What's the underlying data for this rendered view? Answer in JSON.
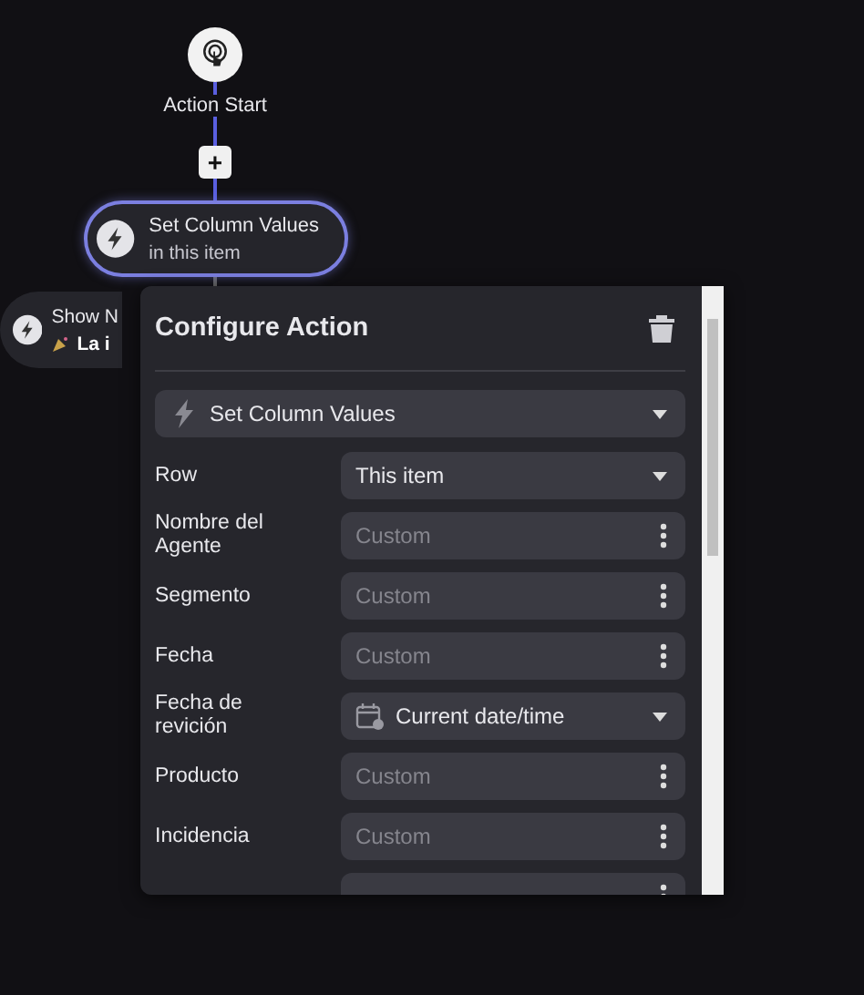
{
  "start_node": {
    "label": "Action Start"
  },
  "add_button": {
    "label": "+"
  },
  "nodes": [
    {
      "title": "Set Column Values",
      "subtitle": "in this item",
      "selected": true
    },
    {
      "title": "Show N",
      "subtitle": "La i",
      "selected": false
    }
  ],
  "panel": {
    "title": "Configure Action",
    "action_select": {
      "value": "Set Column Values"
    },
    "fields": [
      {
        "label": "Row",
        "kind": "select",
        "value": "This item"
      },
      {
        "label": "Nombre del Agente",
        "kind": "custom",
        "placeholder": "Custom"
      },
      {
        "label": "Segmento",
        "kind": "custom",
        "placeholder": "Custom"
      },
      {
        "label": "Fecha",
        "kind": "custom",
        "placeholder": "Custom"
      },
      {
        "label": "Fecha de revición",
        "kind": "date",
        "value": "Current date/time"
      },
      {
        "label": "Producto",
        "kind": "custom",
        "placeholder": "Custom"
      },
      {
        "label": "Incidencia",
        "kind": "custom",
        "placeholder": "Custom"
      },
      {
        "kind": "custom"
      }
    ]
  }
}
